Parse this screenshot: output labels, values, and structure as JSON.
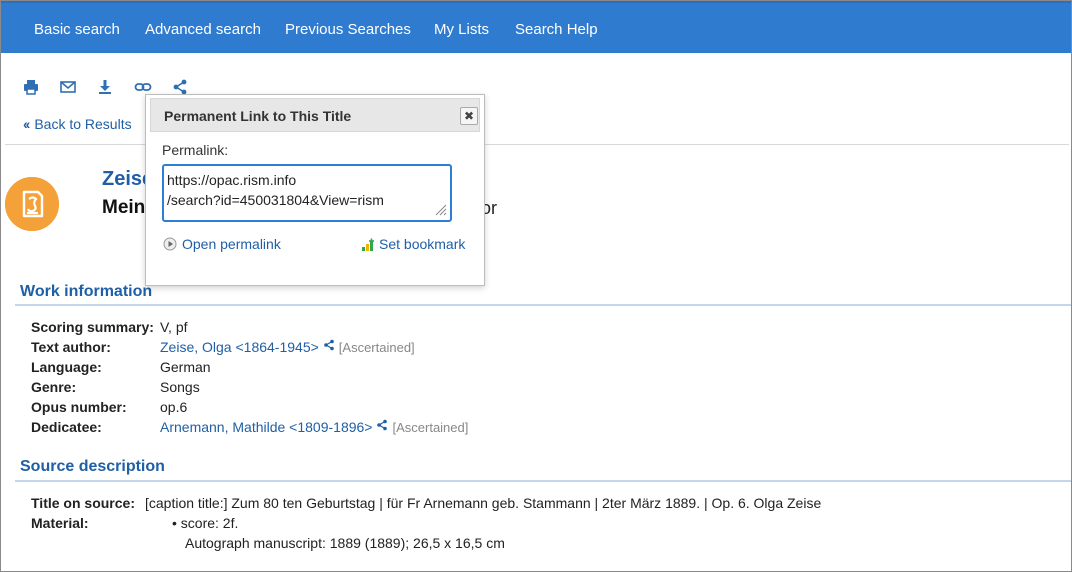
{
  "nav": {
    "items": [
      "Basic search",
      "Advanced search",
      "Previous Searches",
      "My Lists",
      "Search Help"
    ]
  },
  "toolbar": {
    "icons": [
      "print-icon",
      "email-icon",
      "download-icon",
      "link-icon",
      "share-icon"
    ]
  },
  "back_link": "Back to Results",
  "record": {
    "title": "Zeise",
    "subtitle": "Mein",
    "subtitle_tail": "or"
  },
  "popup": {
    "title": "Permanent Link to This Title",
    "close": "✖",
    "permalink_label": "Permalink:",
    "permalink_value": "https://opac.rism.info\n/search?id=450031804&View=rism",
    "open_permalink": "Open permalink",
    "set_bookmark": "Set bookmark"
  },
  "work_info": {
    "heading": "Work information",
    "rows": [
      {
        "label": "Scoring summary:",
        "value": "V, pf"
      },
      {
        "label": "Text author:",
        "value": "Zeise, Olga <1864-1945>",
        "note": "[Ascertained]"
      },
      {
        "label": "Language:",
        "value": "German"
      },
      {
        "label": "Genre:",
        "value": "Songs"
      },
      {
        "label": "Opus number:",
        "value": "op.6"
      },
      {
        "label": "Dedicatee:",
        "value": "Arnemann, Mathilde <1809-1896>",
        "note": "[Ascertained]"
      }
    ]
  },
  "source_desc": {
    "heading": "Source description",
    "title_label": "Title on source:",
    "title_value": "[caption title:] Zum 80 ten Geburtstag | für Fr Arnemann geb. Stammann | 2ter März 1889. | Op. 6. Olga Zeise",
    "material_label": "Material:",
    "material_bullet": "score: 2f.",
    "material_line2": "Autograph manuscript: 1889 (1889); 26,5 x 16,5 cm"
  },
  "colors": {
    "nav_bg": "#2f7bd0",
    "link": "#1f5fa6",
    "logo": "#f4a13a"
  }
}
